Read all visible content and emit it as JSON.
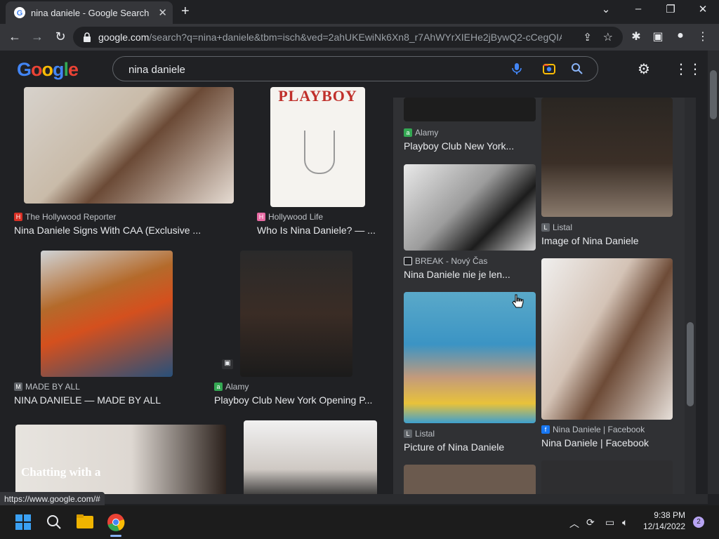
{
  "browser": {
    "tab_title": "nina daniele - Google Search",
    "url_host": "google.com",
    "url_path": "/search?q=nina+daniele&tbm=isch&ved=2ahUKEwiNk6Xn8_r7AhWYrXIEHe2jBywQ2-cCegQIA..."
  },
  "google": {
    "logo_letters": [
      "G",
      "o",
      "o",
      "g",
      "l",
      "e"
    ],
    "logo_colors": [
      "#4285f4",
      "#ea4335",
      "#fbbc05",
      "#4285f4",
      "#34a853",
      "#ea4335"
    ],
    "search_query": "nina daniele"
  },
  "results_left": [
    {
      "source": "The Hollywood Reporter",
      "caption": "Nina Daniele Signs With CAA (Exclusive ..."
    },
    {
      "source": "Hollywood Life",
      "caption": "Who Is Nina Daniele? — ..."
    },
    {
      "source": "MADE BY ALL",
      "caption": "NINA DANIELE — MADE BY ALL"
    },
    {
      "source": "Alamy",
      "caption": "Playboy Club New York Opening P..."
    },
    {
      "overlay_text": "Chatting with a"
    },
    {
      "overlay_text": "PLAYBOY"
    }
  ],
  "results_right": [
    {
      "source": "Alamy",
      "caption": "Playboy Club New York..."
    },
    {
      "source": "Listal",
      "caption": "Image of Nina Daniele"
    },
    {
      "source": "BREAK - Nový Čas",
      "caption": "Nina Daniele nie je len..."
    },
    {
      "source": "Listal",
      "caption": "Picture of Nina Daniele"
    },
    {
      "source": "Nina Daniele | Facebook",
      "caption": "Nina Daniele | Facebook"
    }
  ],
  "status_url": "https://www.google.com/#",
  "taskbar": {
    "time": "9:38 PM",
    "date": "12/14/2022",
    "notification_count": "2"
  }
}
